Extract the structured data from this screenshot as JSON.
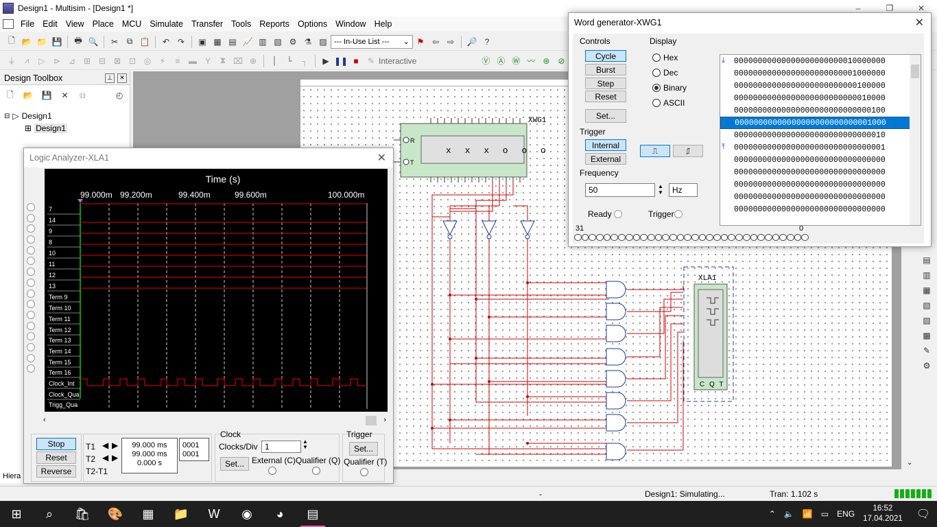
{
  "window": {
    "title": "Design1 - Multisim - [Design1 *]",
    "controls": [
      "–",
      "❐",
      "✕"
    ]
  },
  "menu": [
    "File",
    "Edit",
    "View",
    "Place",
    "MCU",
    "Simulate",
    "Transfer",
    "Tools",
    "Reports",
    "Options",
    "Window",
    "Help"
  ],
  "toolbar": {
    "in_use_list": "--- In-Use List ---",
    "interactive_label": "Interactive"
  },
  "toolbox": {
    "title": "Design Toolbox",
    "tree_root": "Design1",
    "tree_child": "Design1",
    "bottom_tab": "Hiera"
  },
  "circuit": {
    "word_gen_label": "XWG1",
    "word_gen_pins": [
      "R",
      "T"
    ],
    "word_gen_display": "x x x o o o",
    "logic_analyzer_label": "XLA1",
    "logic_analyzer_pins": "C Q T"
  },
  "logic_analyzer": {
    "title": "Logic Analyzer-XLA1",
    "axis_title": "Time (s)",
    "time_ticks": [
      "99.000m",
      "99.200m",
      "99.400m",
      "99.600m",
      "100.000m"
    ],
    "channels": [
      "7",
      "14",
      "9",
      "8",
      "10",
      "11",
      "12",
      "13",
      "Term 9",
      "Term 10",
      "Term 11",
      "Term 12",
      "Term 13",
      "Term 14",
      "Term 15",
      "Term 16",
      "Clock_Int",
      "Clock_Qua",
      "Trigg_Qua"
    ],
    "buttons": {
      "stop": "Stop",
      "reset": "Reset",
      "reverse": "Reverse"
    },
    "t1_label": "T1",
    "t2_label": "T2",
    "t2t1_label": "T2-T1",
    "t1_value": "99.000 ms",
    "t2_value": "99.000 ms",
    "t2t1_value": "0.000 s",
    "t1_hex": "0001",
    "t2_hex": "0001",
    "clock_title": "Clock",
    "clocks_div_label": "Clocks/Div",
    "clocks_div_value": "1",
    "set_label": "Set...",
    "external_label": "External (C)",
    "qualifier_label": "Qualifier (Q)",
    "trigger_title": "Trigger",
    "trigger_set": "Set...",
    "trigger_qualifier": "Qualifier (T)"
  },
  "word_generator": {
    "title": "Word generator-XWG1",
    "controls_title": "Controls",
    "buttons": [
      "Cycle",
      "Burst",
      "Step",
      "Reset"
    ],
    "set_label": "Set...",
    "display_title": "Display",
    "display_options": [
      "Hex",
      "Dec",
      "Binary",
      "ASCII"
    ],
    "display_selected": "Binary",
    "trigger_title": "Trigger",
    "trigger_internal": "Internal",
    "trigger_external": "External",
    "frequency_title": "Frequency",
    "frequency_value": "50",
    "frequency_unit": "Hz",
    "ready_label": "Ready",
    "trigger_label": "Trigger",
    "bit_high": "31",
    "bit_low": "0",
    "words": [
      "00000000000000000000000010000000",
      "00000000000000000000000001000000",
      "00000000000000000000000000100000",
      "00000000000000000000000000010000",
      "00000000000000000000000000000100",
      "00000000000000000000000000001000",
      "00000000000000000000000000000010",
      "00000000000000000000000000000001",
      "00000000000000000000000000000000",
      "00000000000000000000000000000000",
      "00000000000000000000000000000000",
      "00000000000000000000000000000000",
      "00000000000000000000000000000000"
    ],
    "selected_word_index": 5
  },
  "status": {
    "dash": "-",
    "simulating": "Design1: Simulating...",
    "tran": "Tran: 1.102 s"
  },
  "taskbar": {
    "lang": "ENG",
    "time": "16:52",
    "date": "17.04.2021"
  }
}
